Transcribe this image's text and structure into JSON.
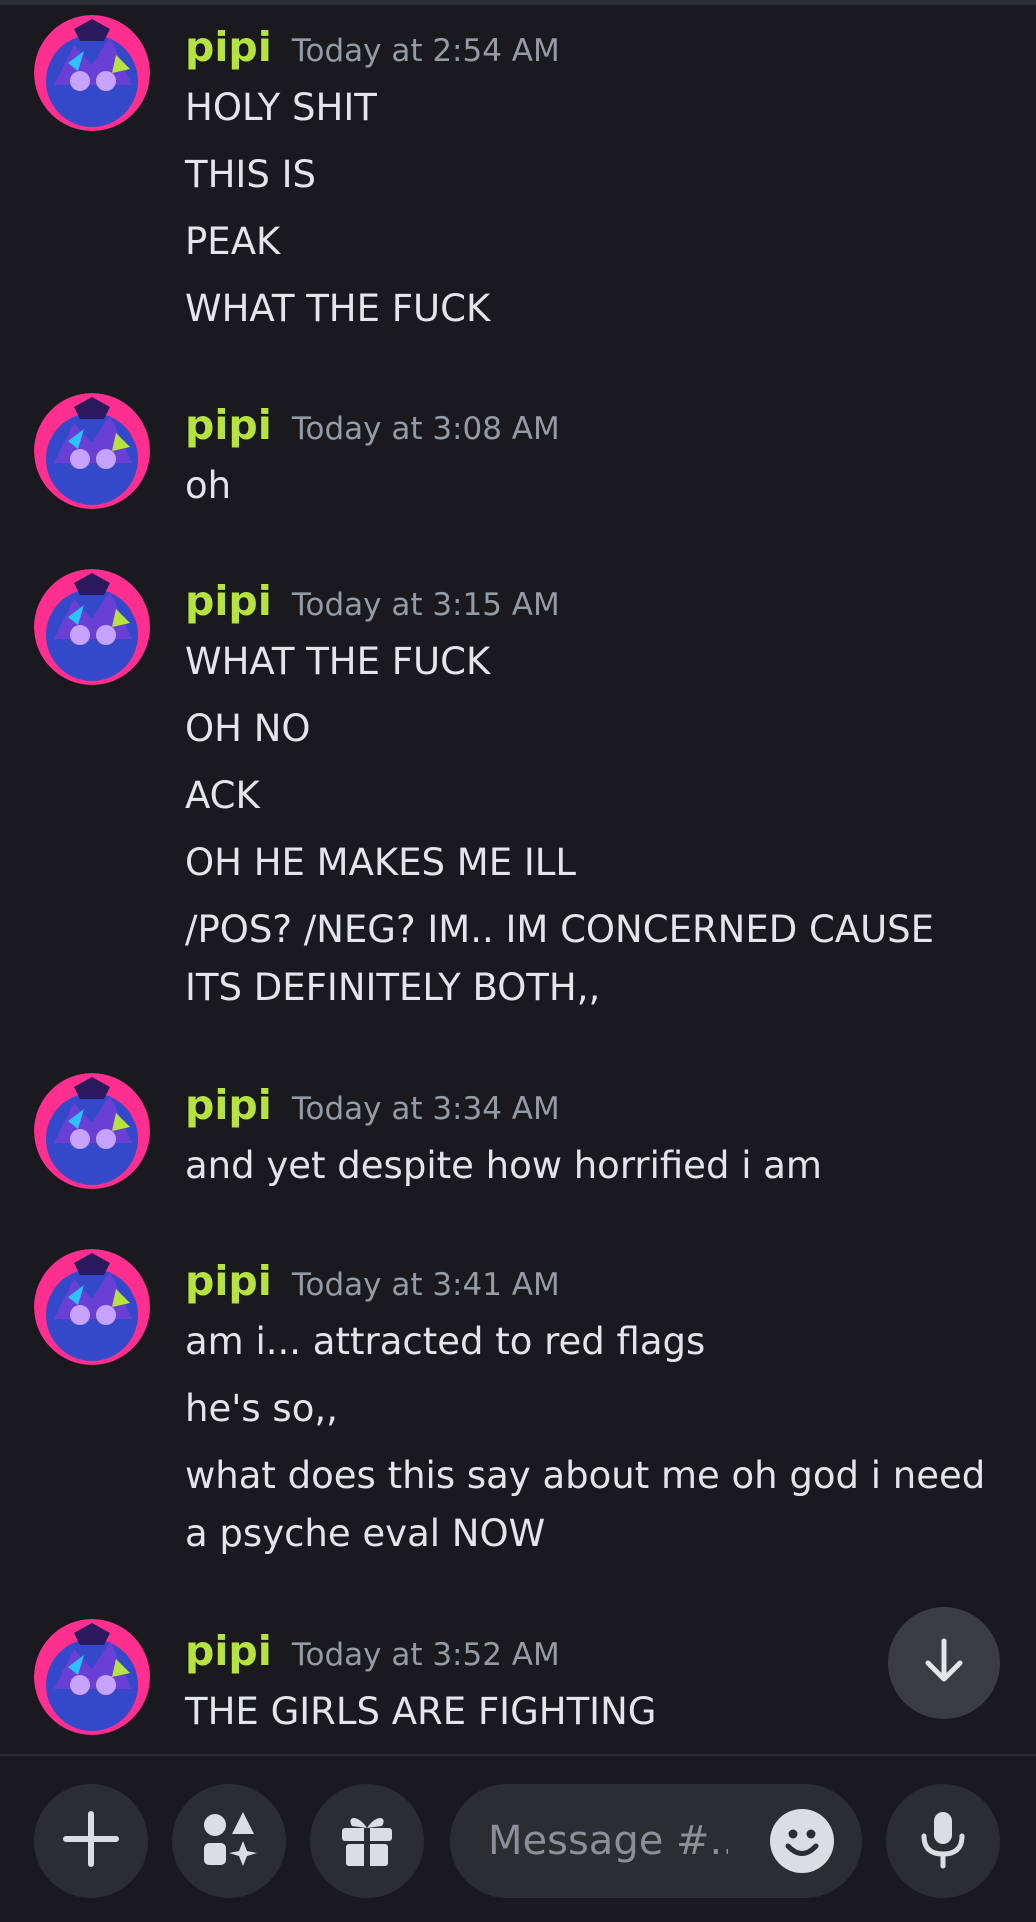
{
  "messages": [
    {
      "username": "pipi",
      "timestamp": "Today at 2:54 AM",
      "lines": [
        "HOLY SHIT",
        "THIS IS",
        "PEAK",
        "WHAT THE FUCK"
      ]
    },
    {
      "username": "pipi",
      "timestamp": "Today at 3:08 AM",
      "lines": [
        "oh"
      ]
    },
    {
      "username": "pipi",
      "timestamp": "Today at 3:15 AM",
      "lines": [
        "WHAT THE FUCK",
        "OH NO",
        "ACK",
        "OH HE MAKES ME ILL",
        "/POS? /NEG? IM.. IM CONCERNED CAUSE ITS DEFINITELY BOTH,,"
      ]
    },
    {
      "username": "pipi",
      "timestamp": "Today at 3:34 AM",
      "lines": [
        "and yet despite how horrified i am"
      ]
    },
    {
      "username": "pipi",
      "timestamp": "Today at 3:41 AM",
      "lines": [
        "am i... attracted to red flags",
        "he's so,,",
        "what does this say about me oh god i need a psyche eval NOW"
      ]
    },
    {
      "username": "pipi",
      "timestamp": "Today at 3:52 AM",
      "lines": [
        "THE GIRLS ARE FIGHTING"
      ]
    }
  ],
  "composer": {
    "placeholder": "Message #..."
  },
  "icons": {
    "scroll_down": "arrow-down-icon",
    "add": "plus-icon",
    "apps": "apps-sparkle-icon",
    "gift": "gift-icon",
    "emoji": "emoji-icon",
    "voice": "microphone-icon"
  },
  "colors": {
    "background": "#1a1a1e",
    "username": "#b6e33f",
    "timestamp": "#949ba4",
    "text": "#e3e5e8",
    "button": "#2b2d31"
  }
}
